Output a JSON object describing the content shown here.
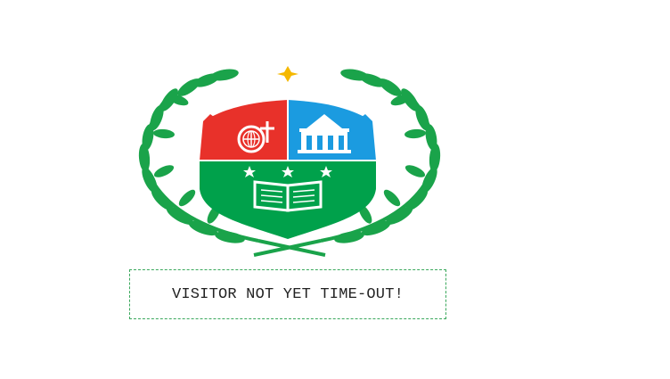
{
  "logo": {
    "icon": "school-crest-logo",
    "colors": {
      "laurel": "#1aa34a",
      "shield_left": "#e8312a",
      "shield_right": "#1b9be0",
      "shield_bottom": "#00a14b",
      "star_top": "#f5b800",
      "stars": "#ffffff"
    }
  },
  "status": {
    "message": "VISITOR NOT YET TIME-OUT!",
    "border_color": "#3aa85c"
  }
}
